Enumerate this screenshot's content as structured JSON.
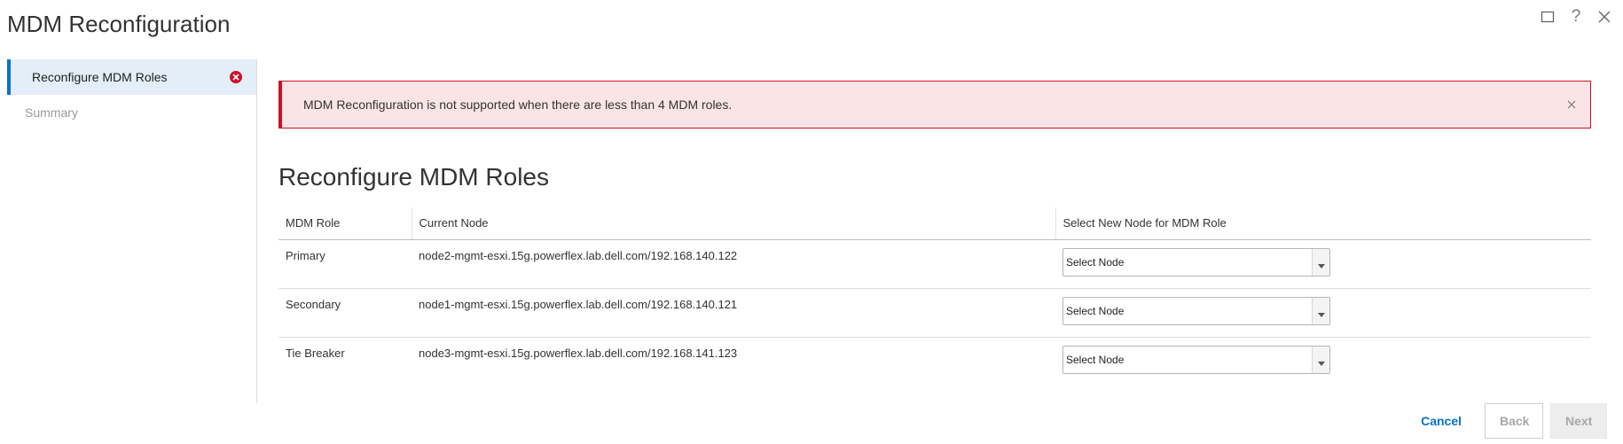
{
  "dialog": {
    "title": "MDM Reconfiguration"
  },
  "window_controls": [
    {
      "icon": "maximize-icon"
    },
    {
      "icon": "help-icon",
      "glyph": "?"
    },
    {
      "icon": "close-icon"
    }
  ],
  "sidebar": {
    "items": [
      {
        "label": "Reconfigure MDM Roles",
        "state": "active",
        "status_icon": "error-icon"
      },
      {
        "label": "Summary",
        "state": "disabled"
      }
    ]
  },
  "alert": {
    "message": "MDM Reconfiguration is not supported when there are less than 4 MDM roles.",
    "type": "error",
    "color": "#ce1126"
  },
  "section": {
    "title": "Reconfigure MDM Roles"
  },
  "table": {
    "columns": [
      "MDM Role",
      "Current Node",
      "Select New Node for MDM Role"
    ],
    "rows": [
      {
        "role": "Primary",
        "current_node": "node2-mgmt-esxi.15g.powerflex.lab.dell.com/192.168.140.122",
        "select_value": "Select Node"
      },
      {
        "role": "Secondary",
        "current_node": "node1-mgmt-esxi.15g.powerflex.lab.dell.com/192.168.140.121",
        "select_value": "Select Node"
      },
      {
        "role": "Tie Breaker",
        "current_node": "node3-mgmt-esxi.15g.powerflex.lab.dell.com/192.168.141.123",
        "select_value": "Select Node"
      }
    ]
  },
  "footer": {
    "cancel_label": "Cancel",
    "back_label": "Back",
    "next_label": "Next"
  },
  "colors": {
    "accent": "#0672cb",
    "error": "#ce1126",
    "alert_bg": "#fbe4e6",
    "active_nav_bg": "#e3eef8"
  }
}
